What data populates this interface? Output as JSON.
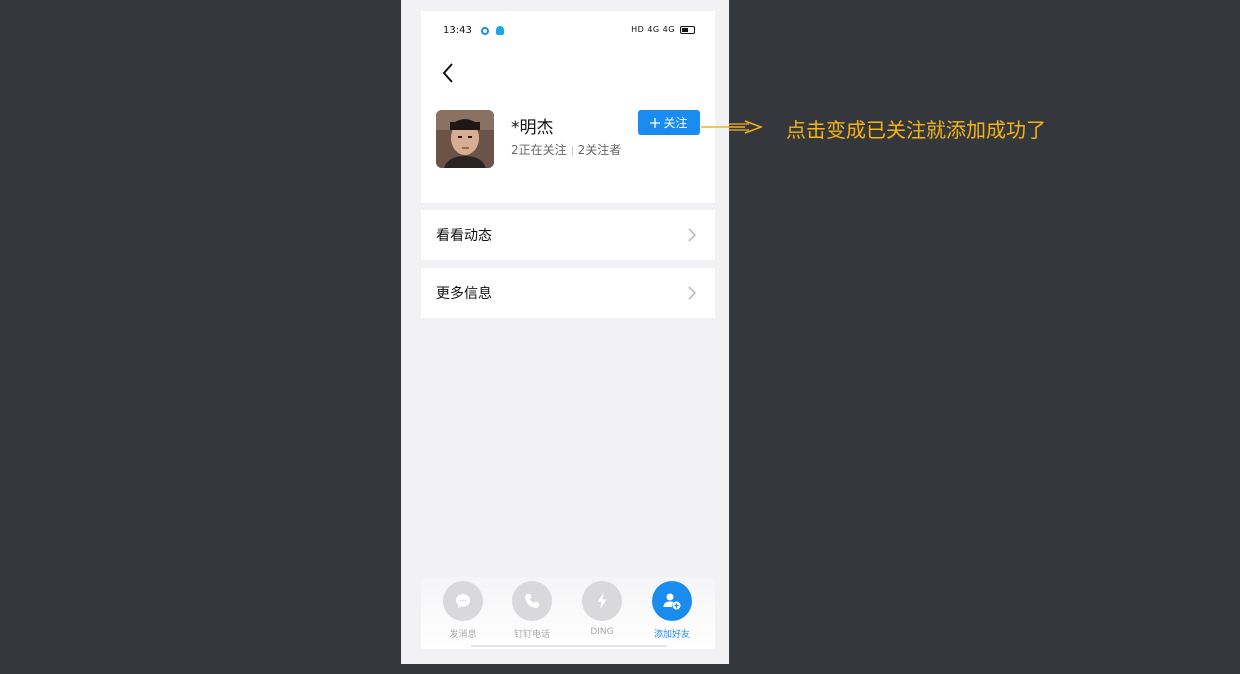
{
  "status_bar": {
    "time": "13:43",
    "right_icons": "HD 4G 4G"
  },
  "profile": {
    "name": "*明杰",
    "following": "2正在关注",
    "followers": "2关注者",
    "follow_button": "关注",
    "follow_icon": "plus-icon"
  },
  "menu": {
    "items": [
      {
        "label": "看看动态"
      },
      {
        "label": "更多信息"
      }
    ]
  },
  "actions": [
    {
      "label": "发消息",
      "icon": "message-icon"
    },
    {
      "label": "钉钉电话",
      "icon": "phone-icon"
    },
    {
      "label": "DING",
      "icon": "lightning-icon"
    },
    {
      "label": "添加好友",
      "icon": "add-friend-icon"
    }
  ],
  "annotation": {
    "text": "点击变成已关注就添加成功了",
    "color": "#f5b317"
  },
  "colors": {
    "accent": "#1a8cf0",
    "background": "#34383d"
  }
}
